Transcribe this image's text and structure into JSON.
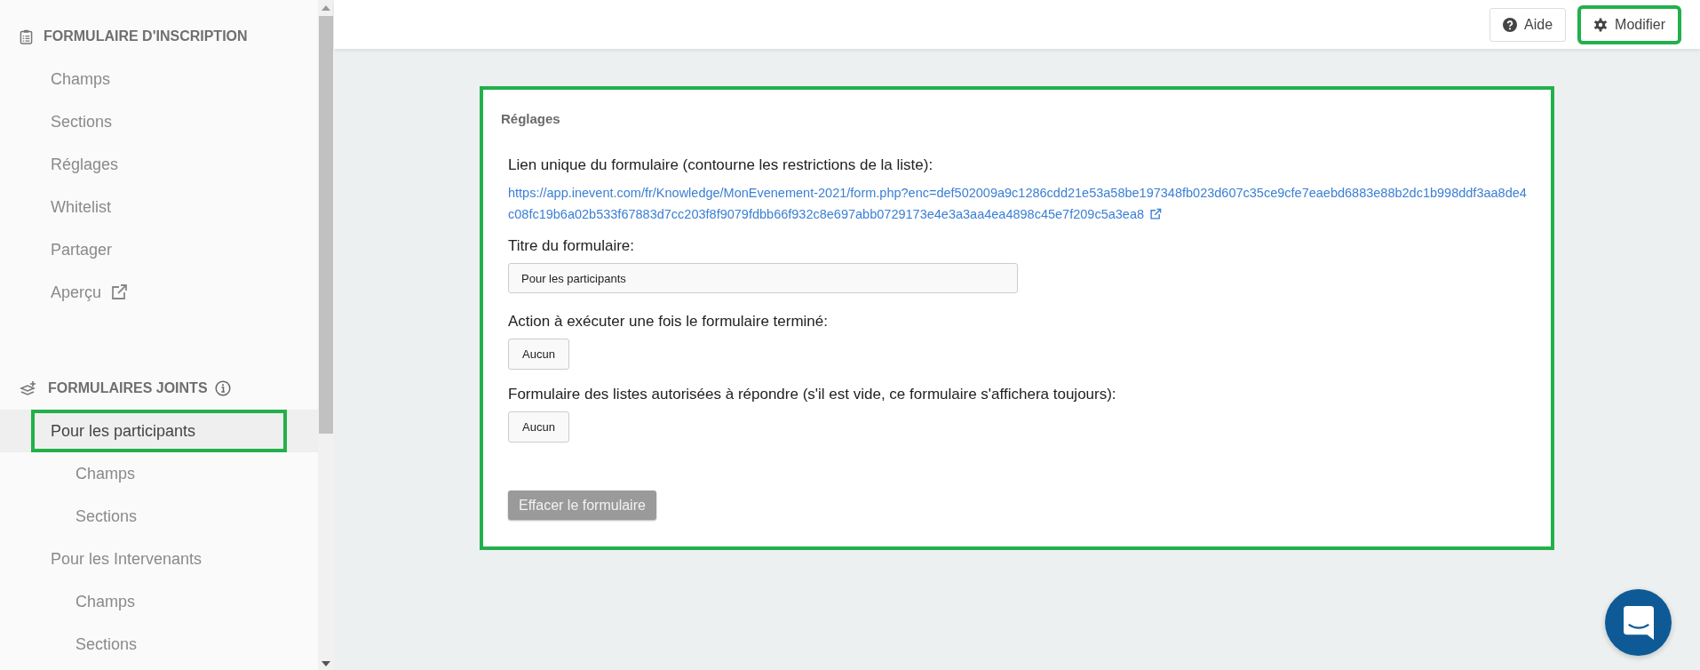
{
  "sidebar": {
    "sections": [
      {
        "title": "FORMULAIRE D'INSCRIPTION",
        "info": false,
        "items": [
          {
            "label": "Champs",
            "selected": false,
            "external": false,
            "highlighted": false
          },
          {
            "label": "Sections",
            "selected": false,
            "external": false,
            "highlighted": false
          },
          {
            "label": "Réglages",
            "selected": false,
            "external": false,
            "highlighted": false
          },
          {
            "label": "Whitelist",
            "selected": false,
            "external": false,
            "highlighted": false
          },
          {
            "label": "Partager",
            "selected": false,
            "external": false,
            "highlighted": false
          },
          {
            "label": "Aperçu",
            "selected": false,
            "external": true,
            "highlighted": false
          }
        ]
      },
      {
        "title": "FORMULAIRES JOINTS",
        "info": true,
        "items": [
          {
            "label": "Pour les participants",
            "selected": true,
            "external": false,
            "highlighted": true,
            "children": [
              {
                "label": "Champs",
                "selected": false
              },
              {
                "label": "Sections",
                "selected": false
              }
            ]
          },
          {
            "label": "Pour les Intervenants",
            "selected": false,
            "external": false,
            "highlighted": false,
            "children": [
              {
                "label": "Champs",
                "selected": false
              },
              {
                "label": "Sections",
                "selected": false
              }
            ]
          }
        ]
      }
    ]
  },
  "toolbar": {
    "buttons": [
      {
        "label": "Aide",
        "highlighted": false
      },
      {
        "label": "Modifier",
        "highlighted": true
      }
    ]
  },
  "settings_card": {
    "title": "Réglages",
    "highlighted": true,
    "link_label": "Lien unique du formulaire (contourne les restrictions de la liste):",
    "link": "https://app.inevent.com/fr/Knowledge/MonEvenement-2021/form.php?enc=def502009a9c1286cdd21e53a58be197348fb023d607c35ce9cfe7eaebd6883e88b2dc1b998ddf3aa8de4c08fc19b6a02b533f67883d7cc203f8f9079fdbb66f932c8e697abb0729173e4e3a3aa4ea4898c45e7f209c5a3ea8",
    "title_label": "Titre du formulaire:",
    "title_value": "Pour les participants",
    "action_label": "Action à exécuter une fois le formulaire terminé:",
    "action_value": "Aucun",
    "lists_label": "Formulaire des listes autorisées à répondre (s'il est vide, ce formulaire s'affichera toujours):",
    "lists_value": "Aucun",
    "delete_button": "Effacer le formulaire"
  }
}
